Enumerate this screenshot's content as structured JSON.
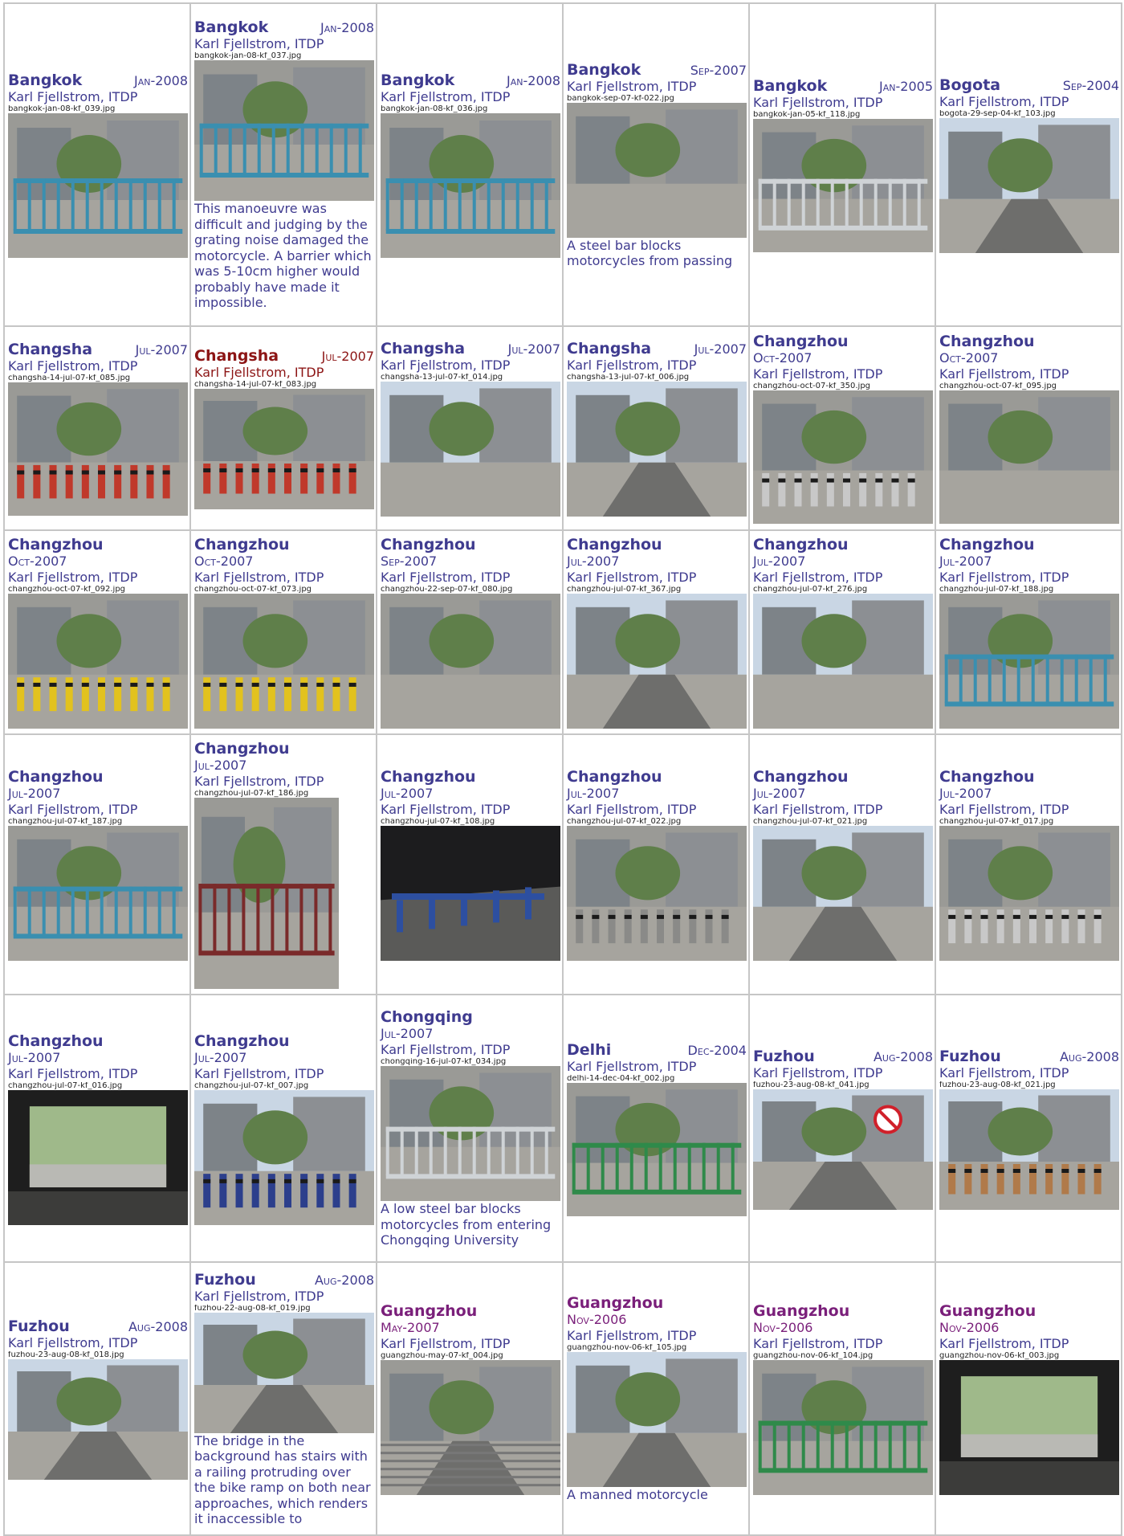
{
  "author": "Karl Fjellstrom,  ITDP",
  "rows": [
    {
      "height": 402,
      "cells": [
        {
          "city": "Bangkok",
          "date": "Jan-2008",
          "file": "bangkok-jan-08-kf_039.jpg",
          "caption": "",
          "layout": "inline",
          "photo": "h-fence",
          "photo_h": 180
        },
        {
          "city": "Bangkok",
          "date": "Jan-2008",
          "file": "bangkok-jan-08-kf_037.jpg",
          "caption": "This manoeuvre was difficult and judging by the grating noise damaged the motorcycle. A barrier which was 5-10cm higher would probably have made it impossible.",
          "layout": "inline",
          "photo": "h-fence",
          "photo_h": 175
        },
        {
          "city": "Bangkok",
          "date": "Jan-2008",
          "file": "bangkok-jan-08-kf_036.jpg",
          "caption": "",
          "layout": "inline",
          "photo": "h-fence",
          "photo_h": 180
        },
        {
          "city": "Bangkok",
          "date": "Sep-2007",
          "file": "bangkok-sep-07-kf-022.jpg",
          "caption": "A steel bar blocks motorcycles from passing",
          "layout": "inline",
          "photo": "h-alley",
          "photo_h": 168
        },
        {
          "city": "Bangkok",
          "date": "Jan-2005",
          "file": "bangkok-jan-05-kf_118.jpg",
          "caption": "",
          "layout": "inline",
          "photo": "h-gate",
          "photo_h": 166
        },
        {
          "city": "Bogota",
          "date": "Sep-2004",
          "file": "bogota-29-sep-04-kf_103.jpg",
          "caption": "",
          "layout": "inline",
          "photo": "h-road",
          "photo_h": 168
        }
      ]
    },
    {
      "height": 254,
      "cells": [
        {
          "city": "Changsha",
          "date": "Jul-2007",
          "file": "changsha-14-jul-07-kf_085.jpg",
          "caption": "",
          "layout": "inline",
          "photo": "h-bollards",
          "photo_h": 166
        },
        {
          "city": "Changsha",
          "date": "Jul-2007",
          "file": "changsha-14-jul-07-kf_083.jpg",
          "caption": "",
          "layout": "inline",
          "photo": "h-bollards",
          "photo_h": 150,
          "accent": "red"
        },
        {
          "city": "Changsha",
          "date": "Jul-2007",
          "file": "changsha-13-jul-07-kf_014.jpg",
          "caption": "",
          "layout": "inline",
          "photo": "h-plaza",
          "photo_h": 168
        },
        {
          "city": "Changsha",
          "date": "Jul-2007",
          "file": "changsha-13-jul-07-kf_006.jpg",
          "caption": "",
          "layout": "inline",
          "photo": "h-street",
          "photo_h": 168
        },
        {
          "city": "Changzhou",
          "date": "Oct-2007",
          "file": "changzhou-oct-07-kf_350.jpg",
          "caption": "",
          "layout": "stack",
          "photo": "h-racks",
          "photo_h": 166
        },
        {
          "city": "Changzhou",
          "date": "Oct-2007",
          "file": "changzhou-oct-07-kf_095.jpg",
          "caption": "",
          "layout": "stack",
          "photo": "h-building",
          "photo_h": 166
        }
      ]
    },
    {
      "height": 254,
      "cells": [
        {
          "city": "Changzhou",
          "date": "Oct-2007",
          "file": "changzhou-oct-07-kf_092.jpg",
          "caption": "",
          "layout": "stack",
          "photo": "h-yellow",
          "photo_h": 168
        },
        {
          "city": "Changzhou",
          "date": "Oct-2007",
          "file": "changzhou-oct-07-kf_073.jpg",
          "caption": "",
          "layout": "stack",
          "photo": "h-yellow",
          "photo_h": 168
        },
        {
          "city": "Changzhou",
          "date": "Sep-2007",
          "file": "changzhou-22-sep-07-kf_080.jpg",
          "caption": "",
          "layout": "stack",
          "photo": "h-shop",
          "photo_h": 168
        },
        {
          "city": "Changzhou",
          "date": "Jul-2007",
          "file": "changzhou-jul-07-kf_367.jpg",
          "caption": "",
          "layout": "stack",
          "photo": "h-street",
          "photo_h": 168
        },
        {
          "city": "Changzhou",
          "date": "Jul-2007",
          "file": "changzhou-jul-07-kf_276.jpg",
          "caption": "",
          "layout": "stack",
          "photo": "h-plaza",
          "photo_h": 168
        },
        {
          "city": "Changzhou",
          "date": "Jul-2007",
          "file": "changzhou-jul-07-kf_188.jpg",
          "caption": "",
          "layout": "stack",
          "photo": "h-fence",
          "photo_h": 168
        }
      ]
    },
    {
      "height": 324,
      "cells": [
        {
          "city": "Changzhou",
          "date": "Jul-2007",
          "file": "changzhou-jul-07-kf_187.jpg",
          "caption": "",
          "layout": "stack",
          "photo": "h-fence",
          "photo_h": 168
        },
        {
          "city": "Changzhou",
          "date": "Jul-2007",
          "file": "changzhou-jul-07-kf_186.jpg",
          "caption": "",
          "layout": "stack",
          "photo": "v-bikes",
          "photo_h": 238,
          "photo_w": 180
        },
        {
          "city": "Changzhou",
          "date": "Jul-2007",
          "file": "changzhou-jul-07-kf_108.jpg",
          "caption": "",
          "layout": "stack",
          "photo": "h-night",
          "photo_h": 168
        },
        {
          "city": "Changzhou",
          "date": "Jul-2007",
          "file": "changzhou-jul-07-kf_022.jpg",
          "caption": "",
          "layout": "stack",
          "photo": "h-bars",
          "photo_h": 168
        },
        {
          "city": "Changzhou",
          "date": "Jul-2007",
          "file": "changzhou-jul-07-kf_021.jpg",
          "caption": "",
          "layout": "stack",
          "photo": "h-street",
          "photo_h": 168
        },
        {
          "city": "Changzhou",
          "date": "Jul-2007",
          "file": "changzhou-jul-07-kf_017.jpg",
          "caption": "",
          "layout": "stack",
          "photo": "h-racks",
          "photo_h": 168
        }
      ]
    },
    {
      "height": 333,
      "cells": [
        {
          "city": "Changzhou",
          "date": "Jul-2007",
          "file": "changzhou-jul-07-kf_016.jpg",
          "caption": "",
          "layout": "stack",
          "photo": "h-tunnel",
          "photo_h": 168
        },
        {
          "city": "Changzhou",
          "date": "Jul-2007",
          "file": "changzhou-jul-07-kf_007.jpg",
          "caption": "",
          "layout": "stack",
          "photo": "h-bollard-row",
          "photo_h": 168
        },
        {
          "city": "Chongqing",
          "date": "Jul-2007",
          "file": "chongqing-16-jul-07-kf_034.jpg",
          "caption": "A low steel bar blocks motorcycles from entering Chongqing University",
          "layout": "stack",
          "photo": "h-gate",
          "photo_h": 168
        },
        {
          "city": "Delhi",
          "date": "Dec-2004",
          "file": "delhi-14-dec-04-kf_002.jpg",
          "caption": "",
          "layout": "inline",
          "photo": "h-green-gate",
          "photo_h": 166
        },
        {
          "city": "Fuzhou",
          "date": "Aug-2008",
          "file": "fuzhou-23-aug-08-kf_041.jpg",
          "caption": "",
          "layout": "inline",
          "photo": "h-sign",
          "photo_h": 150
        },
        {
          "city": "Fuzhou",
          "date": "Aug-2008",
          "file": "fuzhou-23-aug-08-kf_021.jpg",
          "caption": "",
          "layout": "inline",
          "photo": "h-scooters",
          "photo_h": 150
        }
      ]
    },
    {
      "height": 340,
      "cells": [
        {
          "city": "Fuzhou",
          "date": "Aug-2008",
          "file": "fuzhou-23-aug-08-kf_018.jpg",
          "caption": "",
          "layout": "inline",
          "photo": "h-street",
          "photo_h": 150
        },
        {
          "city": "Fuzhou",
          "date": "Aug-2008",
          "file": "fuzhou-22-aug-08-kf_019.jpg",
          "caption": "The bridge in the background has stairs with a railing protruding over the bike ramp on both near approaches, which renders it inaccessible to",
          "layout": "inline",
          "photo": "h-ramp",
          "photo_h": 150
        },
        {
          "city": "Guangzhou",
          "date": "May-2007",
          "file": "guangzhou-may-07-kf_004.jpg",
          "caption": "",
          "layout": "stack",
          "photo": "h-stairs",
          "photo_h": 168,
          "accent": "purple"
        },
        {
          "city": "Guangzhou",
          "date": "Nov-2006",
          "file": "guangzhou-nov-06-kf_105.jpg",
          "caption": "A manned motorcycle",
          "layout": "stack",
          "photo": "h-road",
          "photo_h": 168,
          "accent": "purple"
        },
        {
          "city": "Guangzhou",
          "date": "Nov-2006",
          "file": "guangzhou-nov-06-kf_104.jpg",
          "caption": "",
          "layout": "stack",
          "photo": "h-green-gate",
          "photo_h": 168,
          "accent": "purple"
        },
        {
          "city": "Guangzhou",
          "date": "Nov-2006",
          "file": "guangzhou-nov-06-kf_003.jpg",
          "caption": "",
          "layout": "stack",
          "photo": "h-tunnel",
          "photo_h": 168,
          "accent": "purple"
        }
      ]
    }
  ]
}
